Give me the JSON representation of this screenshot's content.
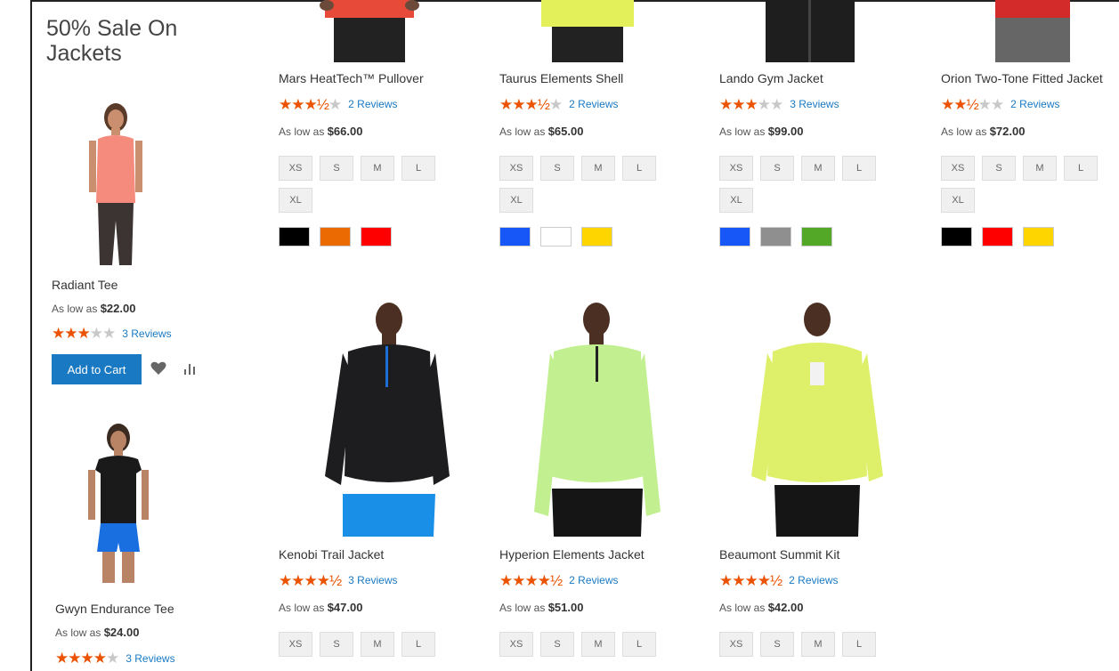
{
  "sidebar": {
    "title": "50% Sale On Jackets",
    "products": [
      {
        "name": "Radiant Tee",
        "price_prefix": "As low as",
        "price": "$22.00",
        "rating": 3,
        "reviews": "3 Reviews",
        "add_to_cart": "Add to Cart"
      },
      {
        "name": "Gwyn Endurance Tee",
        "price_prefix": "As low as",
        "price": "$24.00",
        "rating": 4,
        "reviews": "3 Reviews"
      }
    ]
  },
  "grid": [
    {
      "name": "Mars HeatTech™ Pullover",
      "rating": 3.5,
      "reviews": "2 Reviews",
      "price_prefix": "As low as",
      "price": "$66.00",
      "sizes": [
        "XS",
        "S",
        "M",
        "L",
        "XL"
      ],
      "colors": [
        "#000000",
        "#eb6a02",
        "#ff0000"
      ]
    },
    {
      "name": "Taurus Elements Shell",
      "rating": 3.5,
      "reviews": "2 Reviews",
      "price_prefix": "As low as",
      "price": "$65.00",
      "sizes": [
        "XS",
        "S",
        "M",
        "L",
        "XL"
      ],
      "colors": [
        "#1857f7",
        "#ffffff",
        "#ffd500"
      ]
    },
    {
      "name": "Lando Gym Jacket",
      "rating": 3,
      "reviews": "3 Reviews",
      "price_prefix": "As low as",
      "price": "$99.00",
      "sizes": [
        "XS",
        "S",
        "M",
        "L",
        "XL"
      ],
      "colors": [
        "#1857f7",
        "#8f8f8f",
        "#53a828"
      ]
    },
    {
      "name": "Orion Two-Tone Fitted Jacket",
      "rating": 2.5,
      "reviews": "2 Reviews",
      "price_prefix": "As low as",
      "price": "$72.00",
      "sizes": [
        "XS",
        "S",
        "M",
        "L",
        "XL"
      ],
      "colors": [
        "#000000",
        "#ff0000",
        "#ffd500"
      ]
    },
    {
      "name": "Kenobi Trail Jacket",
      "rating": 4.5,
      "reviews": "3 Reviews",
      "price_prefix": "As low as",
      "price": "$47.00",
      "sizes": [
        "XS",
        "S",
        "M",
        "L"
      ],
      "colors": []
    },
    {
      "name": "Hyperion Elements Jacket",
      "rating": 4.5,
      "reviews": "2 Reviews",
      "price_prefix": "As low as",
      "price": "$51.00",
      "sizes": [
        "XS",
        "S",
        "M",
        "L"
      ],
      "colors": []
    },
    {
      "name": "Beaumont Summit Kit",
      "rating": 4.5,
      "reviews": "2 Reviews",
      "price_prefix": "As low as",
      "price": "$42.00",
      "sizes": [
        "XS",
        "S",
        "M",
        "L"
      ],
      "colors": []
    }
  ],
  "icons": {
    "wishlist": "heart-icon",
    "compare": "compare-icon",
    "star": "star-icon"
  },
  "colors": {
    "accent": "#1979c3",
    "star": "#eb5202"
  }
}
